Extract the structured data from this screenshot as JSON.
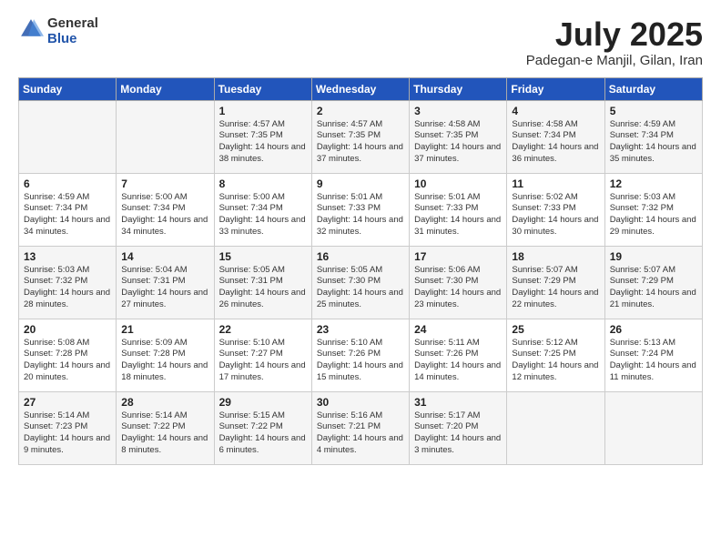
{
  "header": {
    "logo_general": "General",
    "logo_blue": "Blue",
    "month_title": "July 2025",
    "subtitle": "Padegan-e Manjil, Gilan, Iran"
  },
  "weekdays": [
    "Sunday",
    "Monday",
    "Tuesday",
    "Wednesday",
    "Thursday",
    "Friday",
    "Saturday"
  ],
  "weeks": [
    [
      {
        "day": "",
        "sunrise": "",
        "sunset": "",
        "daylight": ""
      },
      {
        "day": "",
        "sunrise": "",
        "sunset": "",
        "daylight": ""
      },
      {
        "day": "1",
        "sunrise": "Sunrise: 4:57 AM",
        "sunset": "Sunset: 7:35 PM",
        "daylight": "Daylight: 14 hours and 38 minutes."
      },
      {
        "day": "2",
        "sunrise": "Sunrise: 4:57 AM",
        "sunset": "Sunset: 7:35 PM",
        "daylight": "Daylight: 14 hours and 37 minutes."
      },
      {
        "day": "3",
        "sunrise": "Sunrise: 4:58 AM",
        "sunset": "Sunset: 7:35 PM",
        "daylight": "Daylight: 14 hours and 37 minutes."
      },
      {
        "day": "4",
        "sunrise": "Sunrise: 4:58 AM",
        "sunset": "Sunset: 7:34 PM",
        "daylight": "Daylight: 14 hours and 36 minutes."
      },
      {
        "day": "5",
        "sunrise": "Sunrise: 4:59 AM",
        "sunset": "Sunset: 7:34 PM",
        "daylight": "Daylight: 14 hours and 35 minutes."
      }
    ],
    [
      {
        "day": "6",
        "sunrise": "Sunrise: 4:59 AM",
        "sunset": "Sunset: 7:34 PM",
        "daylight": "Daylight: 14 hours and 34 minutes."
      },
      {
        "day": "7",
        "sunrise": "Sunrise: 5:00 AM",
        "sunset": "Sunset: 7:34 PM",
        "daylight": "Daylight: 14 hours and 34 minutes."
      },
      {
        "day": "8",
        "sunrise": "Sunrise: 5:00 AM",
        "sunset": "Sunset: 7:34 PM",
        "daylight": "Daylight: 14 hours and 33 minutes."
      },
      {
        "day": "9",
        "sunrise": "Sunrise: 5:01 AM",
        "sunset": "Sunset: 7:33 PM",
        "daylight": "Daylight: 14 hours and 32 minutes."
      },
      {
        "day": "10",
        "sunrise": "Sunrise: 5:01 AM",
        "sunset": "Sunset: 7:33 PM",
        "daylight": "Daylight: 14 hours and 31 minutes."
      },
      {
        "day": "11",
        "sunrise": "Sunrise: 5:02 AM",
        "sunset": "Sunset: 7:33 PM",
        "daylight": "Daylight: 14 hours and 30 minutes."
      },
      {
        "day": "12",
        "sunrise": "Sunrise: 5:03 AM",
        "sunset": "Sunset: 7:32 PM",
        "daylight": "Daylight: 14 hours and 29 minutes."
      }
    ],
    [
      {
        "day": "13",
        "sunrise": "Sunrise: 5:03 AM",
        "sunset": "Sunset: 7:32 PM",
        "daylight": "Daylight: 14 hours and 28 minutes."
      },
      {
        "day": "14",
        "sunrise": "Sunrise: 5:04 AM",
        "sunset": "Sunset: 7:31 PM",
        "daylight": "Daylight: 14 hours and 27 minutes."
      },
      {
        "day": "15",
        "sunrise": "Sunrise: 5:05 AM",
        "sunset": "Sunset: 7:31 PM",
        "daylight": "Daylight: 14 hours and 26 minutes."
      },
      {
        "day": "16",
        "sunrise": "Sunrise: 5:05 AM",
        "sunset": "Sunset: 7:30 PM",
        "daylight": "Daylight: 14 hours and 25 minutes."
      },
      {
        "day": "17",
        "sunrise": "Sunrise: 5:06 AM",
        "sunset": "Sunset: 7:30 PM",
        "daylight": "Daylight: 14 hours and 23 minutes."
      },
      {
        "day": "18",
        "sunrise": "Sunrise: 5:07 AM",
        "sunset": "Sunset: 7:29 PM",
        "daylight": "Daylight: 14 hours and 22 minutes."
      },
      {
        "day": "19",
        "sunrise": "Sunrise: 5:07 AM",
        "sunset": "Sunset: 7:29 PM",
        "daylight": "Daylight: 14 hours and 21 minutes."
      }
    ],
    [
      {
        "day": "20",
        "sunrise": "Sunrise: 5:08 AM",
        "sunset": "Sunset: 7:28 PM",
        "daylight": "Daylight: 14 hours and 20 minutes."
      },
      {
        "day": "21",
        "sunrise": "Sunrise: 5:09 AM",
        "sunset": "Sunset: 7:28 PM",
        "daylight": "Daylight: 14 hours and 18 minutes."
      },
      {
        "day": "22",
        "sunrise": "Sunrise: 5:10 AM",
        "sunset": "Sunset: 7:27 PM",
        "daylight": "Daylight: 14 hours and 17 minutes."
      },
      {
        "day": "23",
        "sunrise": "Sunrise: 5:10 AM",
        "sunset": "Sunset: 7:26 PM",
        "daylight": "Daylight: 14 hours and 15 minutes."
      },
      {
        "day": "24",
        "sunrise": "Sunrise: 5:11 AM",
        "sunset": "Sunset: 7:26 PM",
        "daylight": "Daylight: 14 hours and 14 minutes."
      },
      {
        "day": "25",
        "sunrise": "Sunrise: 5:12 AM",
        "sunset": "Sunset: 7:25 PM",
        "daylight": "Daylight: 14 hours and 12 minutes."
      },
      {
        "day": "26",
        "sunrise": "Sunrise: 5:13 AM",
        "sunset": "Sunset: 7:24 PM",
        "daylight": "Daylight: 14 hours and 11 minutes."
      }
    ],
    [
      {
        "day": "27",
        "sunrise": "Sunrise: 5:14 AM",
        "sunset": "Sunset: 7:23 PM",
        "daylight": "Daylight: 14 hours and 9 minutes."
      },
      {
        "day": "28",
        "sunrise": "Sunrise: 5:14 AM",
        "sunset": "Sunset: 7:22 PM",
        "daylight": "Daylight: 14 hours and 8 minutes."
      },
      {
        "day": "29",
        "sunrise": "Sunrise: 5:15 AM",
        "sunset": "Sunset: 7:22 PM",
        "daylight": "Daylight: 14 hours and 6 minutes."
      },
      {
        "day": "30",
        "sunrise": "Sunrise: 5:16 AM",
        "sunset": "Sunset: 7:21 PM",
        "daylight": "Daylight: 14 hours and 4 minutes."
      },
      {
        "day": "31",
        "sunrise": "Sunrise: 5:17 AM",
        "sunset": "Sunset: 7:20 PM",
        "daylight": "Daylight: 14 hours and 3 minutes."
      },
      {
        "day": "",
        "sunrise": "",
        "sunset": "",
        "daylight": ""
      },
      {
        "day": "",
        "sunrise": "",
        "sunset": "",
        "daylight": ""
      }
    ]
  ]
}
